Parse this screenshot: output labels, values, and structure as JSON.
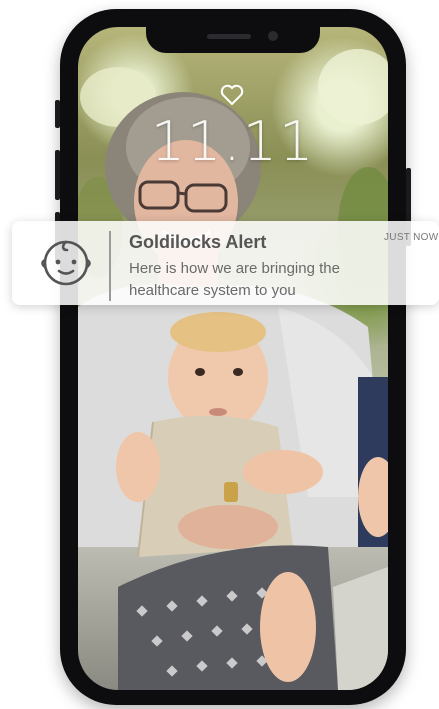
{
  "lock_screen": {
    "time": "11.11",
    "status_icon": "heart-icon"
  },
  "notification": {
    "icon": "baby-face-icon",
    "title": "Goldilocks Alert",
    "time": "JUST NOW",
    "body": "Here is how we are bringing the healthcare system to you"
  },
  "wallpaper": {
    "subject": "photo-grandmother-holding-baby"
  },
  "colors": {
    "phone_frame": "#0d0d0f",
    "notification_bg": "#ffffff",
    "title_text": "#555555",
    "body_text": "#6a6a6a"
  }
}
